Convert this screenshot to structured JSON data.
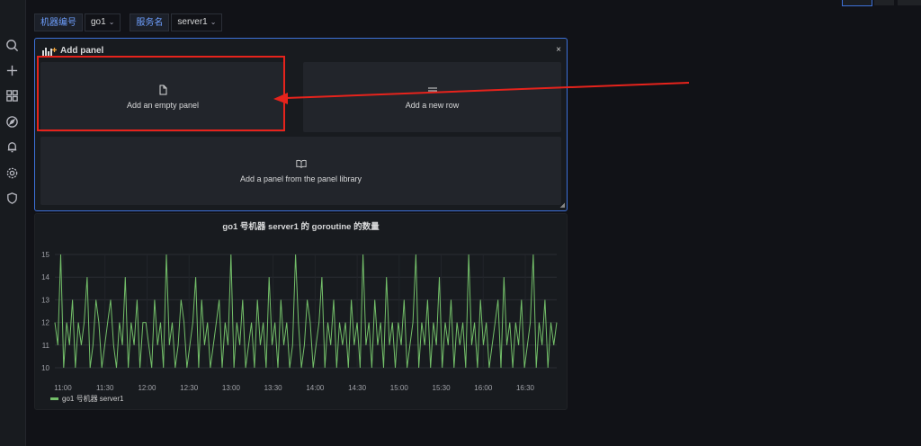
{
  "sidebar": {
    "icons": [
      "search-icon",
      "plus-icon",
      "dashboards-icon",
      "explore-icon",
      "alert-bell-icon",
      "gear-icon",
      "shield-icon"
    ]
  },
  "variables": [
    {
      "label": "机器编号",
      "value": "go1"
    },
    {
      "label": "服务名",
      "value": "server1"
    }
  ],
  "add_panel": {
    "title": "Add panel",
    "close": "×",
    "options": {
      "empty": "Add an empty panel",
      "row": "Add a new row",
      "library": "Add a panel from the panel library"
    }
  },
  "colors": {
    "accent": "#3d71d9",
    "highlight": "#e6231c",
    "series": "#73bf69"
  },
  "graph_panel": {
    "title": "go1 号机器 server1 的 goroutine 的数量",
    "legend": "go1 号机器 server1"
  },
  "chart_data": {
    "type": "line",
    "title": "go1 号机器 server1 的 goroutine 的数量",
    "x_ticks": [
      "11:00",
      "11:30",
      "12:00",
      "12:30",
      "13:00",
      "13:30",
      "14:00",
      "14:30",
      "15:00",
      "15:30",
      "16:00",
      "16:30"
    ],
    "y_ticks": [
      10,
      11,
      12,
      13,
      14,
      15
    ],
    "ylim": [
      10,
      15
    ],
    "grid": true,
    "legend_placement": "bottom-left",
    "series": [
      {
        "name": "go1 号机器 server1",
        "color": "#73bf69",
        "values": [
          12,
          11,
          15,
          10,
          12,
          11,
          13,
          10,
          12,
          11,
          12,
          14,
          10,
          11,
          13,
          12,
          10,
          11,
          12,
          13,
          11,
          10,
          12,
          11,
          14,
          10,
          12,
          11,
          13,
          10,
          12,
          12,
          11,
          10,
          13,
          11,
          12,
          10,
          15,
          11,
          12,
          10,
          11,
          13,
          12,
          10,
          11,
          12,
          14,
          10,
          13,
          11,
          12,
          10,
          11,
          12,
          13,
          10,
          12,
          11,
          15,
          10,
          12,
          11,
          13,
          10,
          11,
          12,
          10,
          13,
          11,
          12,
          10,
          14,
          11,
          12,
          10,
          13,
          11,
          12,
          10,
          11,
          15,
          12,
          10,
          11,
          13,
          12,
          10,
          11,
          12,
          14,
          10,
          12,
          11,
          13,
          10,
          12,
          11,
          12,
          10,
          13,
          11,
          12,
          10,
          15,
          11,
          12,
          10,
          13,
          11,
          12,
          10,
          14,
          11,
          12,
          10,
          12,
          11,
          13,
          10,
          11,
          12,
          15,
          10,
          12,
          11,
          13,
          10,
          12,
          11,
          14,
          10,
          12,
          11,
          13,
          10,
          12,
          11,
          12,
          10,
          15,
          11,
          12,
          10,
          13,
          11,
          12,
          10,
          11,
          12,
          13,
          10,
          14,
          11,
          12,
          10,
          12,
          11,
          13,
          10,
          11,
          12,
          15,
          10,
          12,
          11,
          13,
          10,
          12,
          11,
          12
        ]
      }
    ]
  }
}
